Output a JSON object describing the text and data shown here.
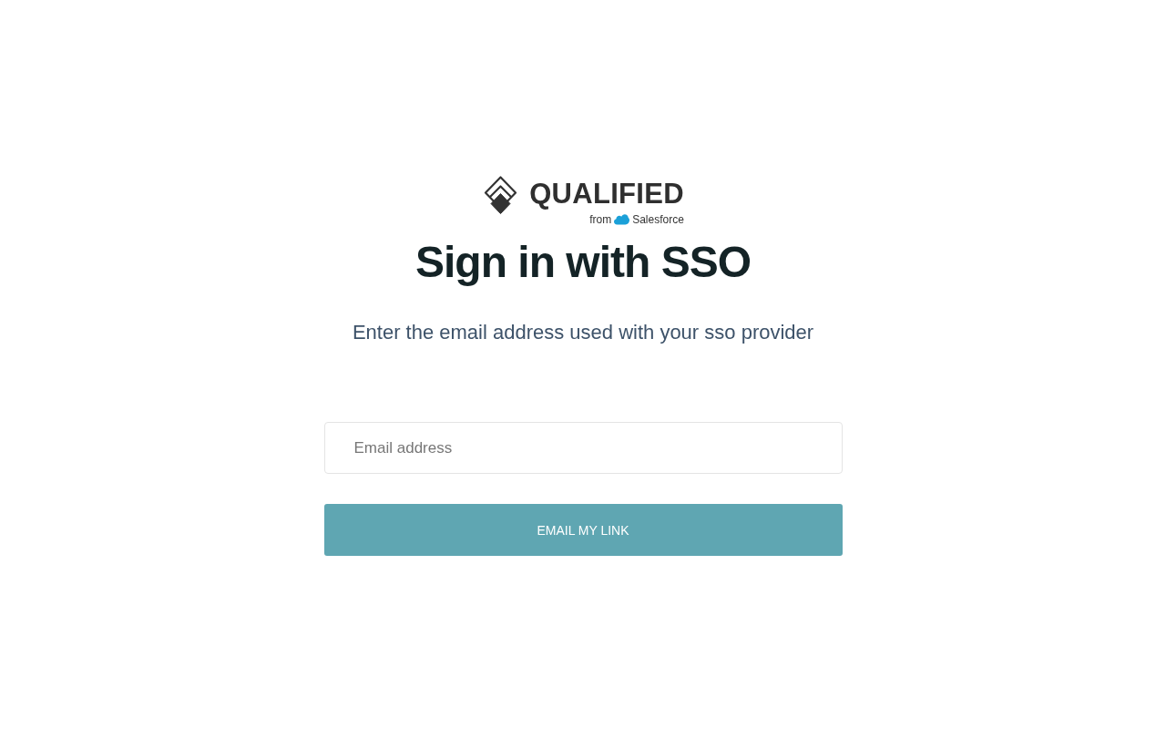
{
  "logo": {
    "wordmark": "QUALIFIED",
    "tagline": {
      "prefix": "from",
      "brand": "Salesforce"
    }
  },
  "heading": "Sign in with SSO",
  "subheading": "Enter the email address used with your sso provider",
  "email_field": {
    "placeholder": "Email address"
  },
  "submit_button": {
    "label": "EMAIL MY LINK"
  }
}
